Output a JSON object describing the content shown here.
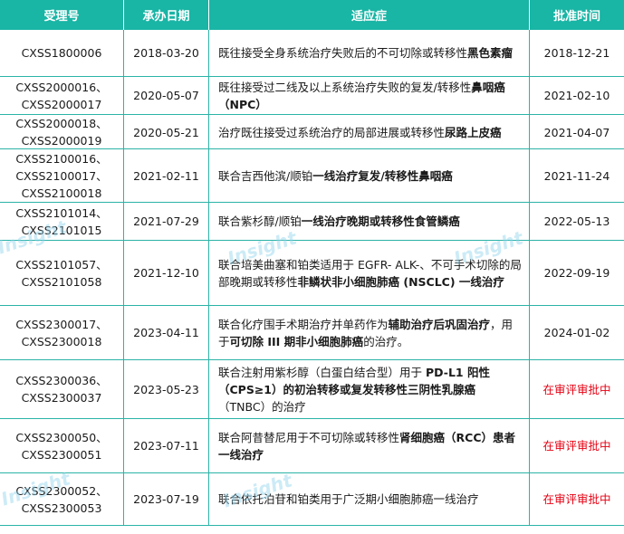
{
  "header": {
    "col_id": "受理号",
    "col_date": "承办日期",
    "col_indication": "适应症",
    "col_approval": "批准时间"
  },
  "rows": [
    {
      "ids": [
        "CXSS1800006"
      ],
      "date": "2018-03-20",
      "indication": [
        {
          "t": "既往接受全身系统治疗失败后的不可切除或转移性",
          "b": false
        },
        {
          "t": "黑色素瘤",
          "b": true
        }
      ],
      "approval": "2018-12-21",
      "pending": false
    },
    {
      "ids": [
        "CXSS2000016、",
        "CXSS2000017"
      ],
      "date": "2020-05-07",
      "indication": [
        {
          "t": "既往接受过二线及以上系统治疗失败的复发/转移性",
          "b": false
        },
        {
          "t": "鼻咽癌（NPC）",
          "b": true
        }
      ],
      "approval": "2021-02-10",
      "pending": false
    },
    {
      "ids": [
        "CXSS2000018、",
        "CXSS2000019"
      ],
      "date": "2020-05-21",
      "indication": [
        {
          "t": "治疗既往接受过系统治疗的局部进展或转移性",
          "b": false
        },
        {
          "t": "尿路上皮癌",
          "b": true
        }
      ],
      "approval": "2021-04-07",
      "pending": false
    },
    {
      "ids": [
        "CXSS2100016、",
        "CXSS2100017、",
        "CXSS2100018"
      ],
      "date": "2021-02-11",
      "indication": [
        {
          "t": "联合吉西他滨/顺铂",
          "b": false
        },
        {
          "t": "一线治疗复发/转移性鼻咽癌",
          "b": true
        }
      ],
      "approval": "2021-11-24",
      "pending": false
    },
    {
      "ids": [
        "CXSS2101014、",
        "CXSS2101015"
      ],
      "date": "2021-07-29",
      "indication": [
        {
          "t": "联合紫杉醇/顺铂",
          "b": false
        },
        {
          "t": "一线治疗晚期或转移性食管鳞癌",
          "b": true
        }
      ],
      "approval": "2022-05-13",
      "pending": false
    },
    {
      "ids": [
        "CXSS2101057、",
        "CXSS2101058"
      ],
      "date": "2021-12-10",
      "indication": [
        {
          "t": "联合培美曲塞和铂类适用于 EGFR- ALK-、不可手术切除的局部晚期或转移性",
          "b": false
        },
        {
          "t": "非鳞状非小细胞肺癌 (NSCLC) 一线治疗",
          "b": true
        }
      ],
      "approval": "2022-09-19",
      "pending": false
    },
    {
      "ids": [
        "CXSS2300017、",
        "CXSS2300018"
      ],
      "date": "2023-04-11",
      "indication": [
        {
          "t": "联合化疗围手术期治疗并单药作为",
          "b": false
        },
        {
          "t": "辅助治疗后巩固治疗",
          "b": true
        },
        {
          "t": "，用于",
          "b": false
        },
        {
          "t": "可切除 III 期非小细胞肺癌",
          "b": true
        },
        {
          "t": "的治疗。",
          "b": false
        }
      ],
      "approval": "2024-01-02",
      "pending": false
    },
    {
      "ids": [
        "CXSS2300036、",
        "CXSS2300037"
      ],
      "date": "2023-05-23",
      "indication": [
        {
          "t": "联合注射用紫杉醇（白蛋白结合型）用于 ",
          "b": false
        },
        {
          "t": "PD-L1 阳性（CPS≥1）的初治转移或复发转移性三阴性乳腺癌",
          "b": true
        },
        {
          "t": "（TNBC）的治疗",
          "b": false
        }
      ],
      "approval": "在审评审批中",
      "pending": true
    },
    {
      "ids": [
        "CXSS2300050、",
        "CXSS2300051"
      ],
      "date": "2023-07-11",
      "indication": [
        {
          "t": "联合阿昔替尼用于不可切除或转移性",
          "b": false
        },
        {
          "t": "肾细胞癌（RCC）患者一线治疗",
          "b": true
        }
      ],
      "approval": "在审评审批中",
      "pending": true
    },
    {
      "ids": [
        "CXSS2300052、",
        "CXSS2300053"
      ],
      "date": "2023-07-19",
      "indication": [
        {
          "t": "联合依托泊苷和铂类用于广泛期小细胞肺癌一线治疗",
          "b": false
        }
      ],
      "approval": "在审评审批中",
      "pending": true
    }
  ],
  "watermark": {
    "text": "Insight",
    "colors": {
      "header_bg": "#19b5a5",
      "border": "#2bb3a7",
      "pending": "#e60012"
    }
  }
}
